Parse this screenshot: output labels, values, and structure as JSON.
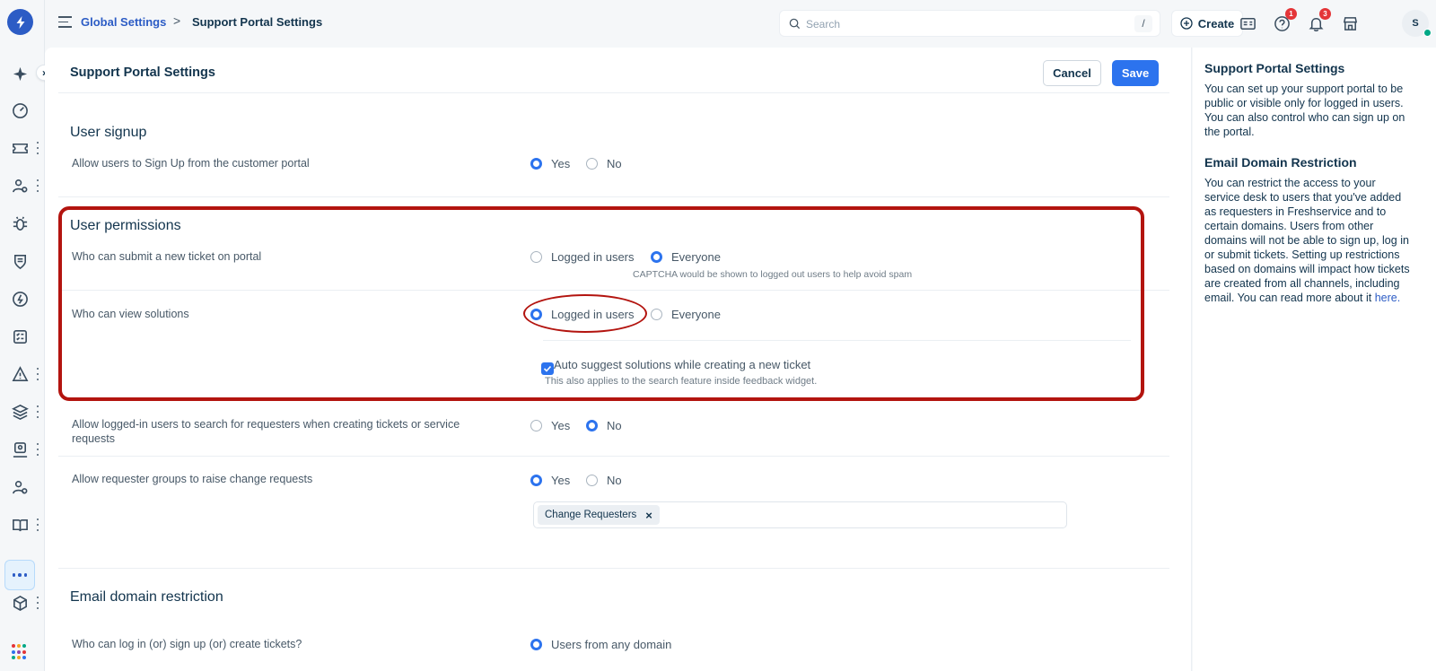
{
  "breadcrumb": {
    "parent": "Global Settings",
    "separator": ">",
    "current": "Support Portal Settings"
  },
  "search": {
    "placeholder": "Search",
    "shortcut": "/"
  },
  "topbar": {
    "create_label": "Create",
    "help_badge": "1",
    "notifications_badge": "3",
    "avatar_initial": "S"
  },
  "page": {
    "title": "Support Portal Settings",
    "cancel_label": "Cancel",
    "save_label": "Save"
  },
  "user_signup": {
    "title": "User signup",
    "label": "Allow users to Sign Up from the customer portal",
    "options": [
      "Yes",
      "No"
    ],
    "selected": "Yes"
  },
  "user_permissions": {
    "title": "User permissions",
    "submit_ticket": {
      "label": "Who can submit a new ticket on portal",
      "options": [
        "Logged in users",
        "Everyone"
      ],
      "selected": "Everyone",
      "hint": "CAPTCHA would be shown to logged out users to help avoid spam"
    },
    "view_solutions": {
      "label": "Who can view solutions",
      "options": [
        "Logged in users",
        "Everyone"
      ],
      "selected": "Logged in users"
    },
    "auto_suggest": {
      "label": "Auto suggest solutions while creating a new ticket",
      "checked": true,
      "hint": "This also applies to the search feature inside feedback widget."
    }
  },
  "search_requesters": {
    "label": "Allow logged-in users to search for requesters when creating tickets or service requests",
    "options": [
      "Yes",
      "No"
    ],
    "selected": "No"
  },
  "change_requests": {
    "label": "Allow requester groups to raise change requests",
    "options": [
      "Yes",
      "No"
    ],
    "selected": "Yes",
    "tag": "Change Requesters"
  },
  "email_domain": {
    "title": "Email domain restriction",
    "label": "Who can log in (or) sign up (or) create tickets?",
    "option": "Users from any domain"
  },
  "help": {
    "title1": "Support Portal Settings",
    "text1": "You can set up your support portal to be public or visible only for logged in users. You can also control who can sign up on the portal.",
    "title2": "Email Domain Restriction",
    "text2": "You can restrict the access to your service desk to users that you've added as requesters in Freshservice and to certain domains. Users from other domains will not be able to sign up, log in or submit tickets. Setting up restrictions based on domains will impact how tickets are created from all channels, including email. You can read more about it",
    "link": "here."
  },
  "colors": {
    "primary": "#2c73ee",
    "brand": "#2c5cc5",
    "highlight": "#b3140f",
    "text": "#12344d"
  },
  "icons": [
    "freshservice-logo-icon",
    "sparkle-icon",
    "dashboard-icon",
    "tickets-icon",
    "problems-icon",
    "bug-icon",
    "shield-icon",
    "change-icon",
    "tasks-icon",
    "alert-icon",
    "layers-icon",
    "requester-icon",
    "users-icon",
    "book-icon",
    "more-icon",
    "box-icon",
    "apps-grid-icon"
  ]
}
